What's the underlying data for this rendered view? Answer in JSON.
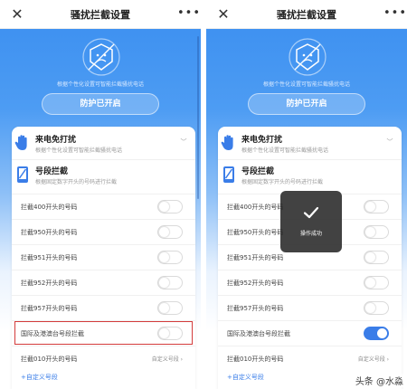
{
  "left_screen": {
    "header": {
      "close_glyph": "✕",
      "title": "骚扰拦截设置",
      "more_glyph": "•••"
    },
    "hero": {
      "description": "根据个性化设置可智能拦截骚扰电话",
      "protect_button": "防护已开启",
      "icon": "shield-face-icon"
    },
    "sections": [
      {
        "title": "来电免打扰",
        "desc": "根据个性化设置可智能拦截骚扰电话",
        "icon": "hand-stop-icon",
        "chevron": "﹀"
      },
      {
        "title": "号段拦截",
        "desc": "根据固定数字开头的号码进行拦截",
        "icon": "phone-block-icon"
      }
    ],
    "rows": [
      {
        "label": "拦截400开头的号码",
        "on": false
      },
      {
        "label": "拦截950开头的号码",
        "on": false
      },
      {
        "label": "拦截951开头的号码",
        "on": false
      },
      {
        "label": "拦截952开头的号码",
        "on": false
      },
      {
        "label": "拦截957开头的号码",
        "on": false
      },
      {
        "label": "国际及港澳台号段拦截",
        "on": false,
        "highlighted": true
      }
    ],
    "custom_row": {
      "label": "拦截010开头的号码",
      "right": "自定义号段 ›"
    },
    "add_link": "+自定义号段"
  },
  "right_screen": {
    "header": {
      "close_glyph": "✕",
      "title": "骚扰拦截设置",
      "more_glyph": "•••"
    },
    "hero": {
      "description": "根据个性化设置可智能拦截骚扰电话",
      "protect_button": "防护已开启",
      "icon": "shield-face-icon"
    },
    "sections": [
      {
        "title": "来电免打扰",
        "desc": "根据个性化设置可智能拦截骚扰电话",
        "icon": "hand-stop-icon",
        "chevron": "﹀"
      },
      {
        "title": "号段拦截",
        "desc": "根据固定数字开头的号码进行拦截",
        "icon": "phone-block-icon"
      }
    ],
    "rows": [
      {
        "label": "拦截400开头的号码",
        "on": false
      },
      {
        "label": "拦截950开头的号码",
        "on": false
      },
      {
        "label": "拦截951开头的号码",
        "on": false
      },
      {
        "label": "拦截952开头的号码",
        "on": false
      },
      {
        "label": "拦截957开头的号码",
        "on": false
      },
      {
        "label": "国际及港澳台号段拦截",
        "on": true
      }
    ],
    "custom_row": {
      "label": "拦截010开头的号码",
      "right": "自定义号段 ›"
    },
    "add_link": "+自定义号段",
    "toast": {
      "text": "操作成功",
      "icon": "checkmark-icon"
    }
  },
  "watermark": "头条 @水淼",
  "colors": {
    "accent": "#3a7de8",
    "highlight": "#d33b3b",
    "header_bg": "#3a8ef0"
  }
}
